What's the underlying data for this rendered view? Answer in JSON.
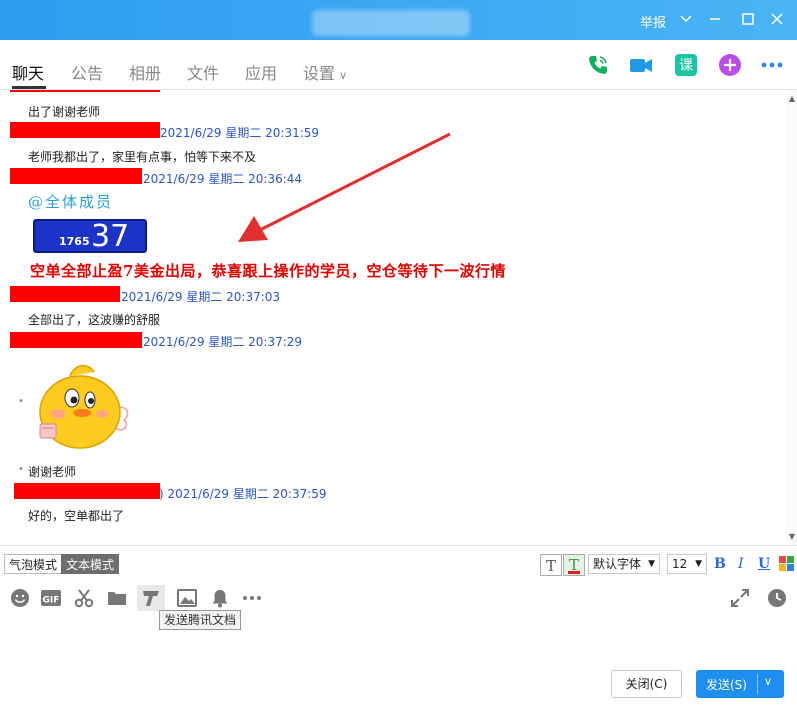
{
  "titlebar": {
    "report": "举报",
    "icons": [
      "chevron-down-icon",
      "minimize-icon",
      "maximize-icon",
      "close-icon"
    ]
  },
  "tabs": [
    {
      "label": "聊天"
    },
    {
      "label": "公告"
    },
    {
      "label": "相册"
    },
    {
      "label": "文件"
    },
    {
      "label": "应用"
    },
    {
      "label": "设置"
    }
  ],
  "chat": {
    "messages": [
      {
        "text": "出了谢谢老师"
      },
      {
        "timestamp": "2021/6/29 星期二 20:31:59"
      },
      {
        "text": "老师我都出了，家里有点事，怕等下来不及"
      },
      {
        "timestamp": "2021/6/29 星期二 20:36:44"
      },
      {
        "at": "@全体成员"
      },
      {
        "price_small": "1765",
        "price_big": "37"
      },
      {
        "announcement": "空单全部止盈7美金出局，恭喜跟上操作的学员，空仓等待下一波行情"
      },
      {
        "timestamp": "2021/6/29 星期二 20:37:03"
      },
      {
        "text": "全部出了，这波赚的舒服"
      },
      {
        "timestamp": "2021/6/29 星期二 20:37:29"
      },
      {
        "text": "谢谢老师"
      },
      {
        "timestamp": "2021/6/29 星期二 20:37:59"
      },
      {
        "text": "好的，空单都出了"
      }
    ]
  },
  "modebar": {
    "bubble_mode": "气泡模式",
    "text_mode": "文本模式",
    "font": "默认字体",
    "size": "12",
    "bold": "B",
    "italic": "I",
    "underline": "U"
  },
  "actions": {
    "icons": [
      "emoji-icon",
      "gif-icon",
      "scissors-icon",
      "folder-icon",
      "tencent-docs-icon",
      "image-icon",
      "bell-icon",
      "more-icon"
    ],
    "tooltip": "发送腾讯文档"
  },
  "buttons": {
    "close": "关闭(C)",
    "send": "发送(S)"
  },
  "colors": {
    "titlebar": "#3aa8f2",
    "timestamp": "#2b57c9",
    "announcement": "#e00000",
    "at_all": "#2aa0d8",
    "send_button": "#1e8ff0"
  }
}
